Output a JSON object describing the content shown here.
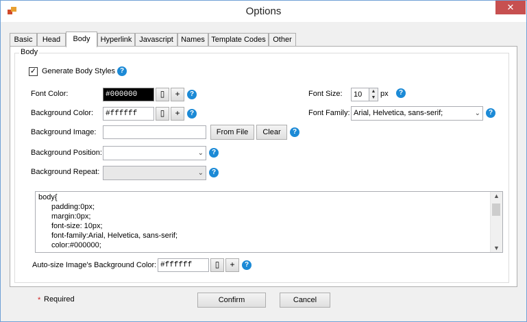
{
  "window": {
    "title": "Options"
  },
  "tabs": [
    {
      "label": "Basic"
    },
    {
      "label": "Head"
    },
    {
      "label": "Body"
    },
    {
      "label": "Hyperlink"
    },
    {
      "label": "Javascript"
    },
    {
      "label": "Names"
    },
    {
      "label": "Template Codes"
    },
    {
      "label": "Other"
    }
  ],
  "body_group": {
    "label": "Body",
    "generate_label": "Generate Body Styles",
    "generate_checked": true,
    "font_color_label": "Font Color:",
    "font_color_value": "#000000",
    "bg_color_label": "Background Color:",
    "bg_color_value": "#ffffff",
    "bg_image_label": "Background Image:",
    "bg_image_value": "",
    "from_file_label": "From File",
    "clear_label": "Clear",
    "bg_position_label": "Background Position:",
    "bg_position_value": "",
    "bg_repeat_label": "Background Repeat:",
    "bg_repeat_value": "",
    "font_size_label": "Font Size:",
    "font_size_value": "10",
    "font_size_unit": "px",
    "font_family_label": "Font Family:",
    "font_family_value": "Arial, Helvetica, sans-serif;",
    "plus_label": "+",
    "help_glyph": "?",
    "css_lines": [
      "body{",
      "padding:0px;",
      "margin:0px;",
      "font-size: 10px;",
      "font-family:Arial, Helvetica, sans-serif;",
      "color:#000000;"
    ],
    "autosize_label": "Auto-size Image's Background Color:",
    "autosize_value": "#ffffff"
  },
  "footer": {
    "required_star": "*",
    "required_label": "Required",
    "confirm_label": "Confirm",
    "cancel_label": "Cancel"
  },
  "colors": {
    "accent": "#1c8ad6",
    "close": "#c75050",
    "required_star": "#d02020"
  },
  "icons": [
    "app-icon",
    "close-icon",
    "help-icon",
    "color-picker-icon",
    "chevron-down-icon",
    "check-icon",
    "scroll-up-icon",
    "scroll-down-icon"
  ]
}
